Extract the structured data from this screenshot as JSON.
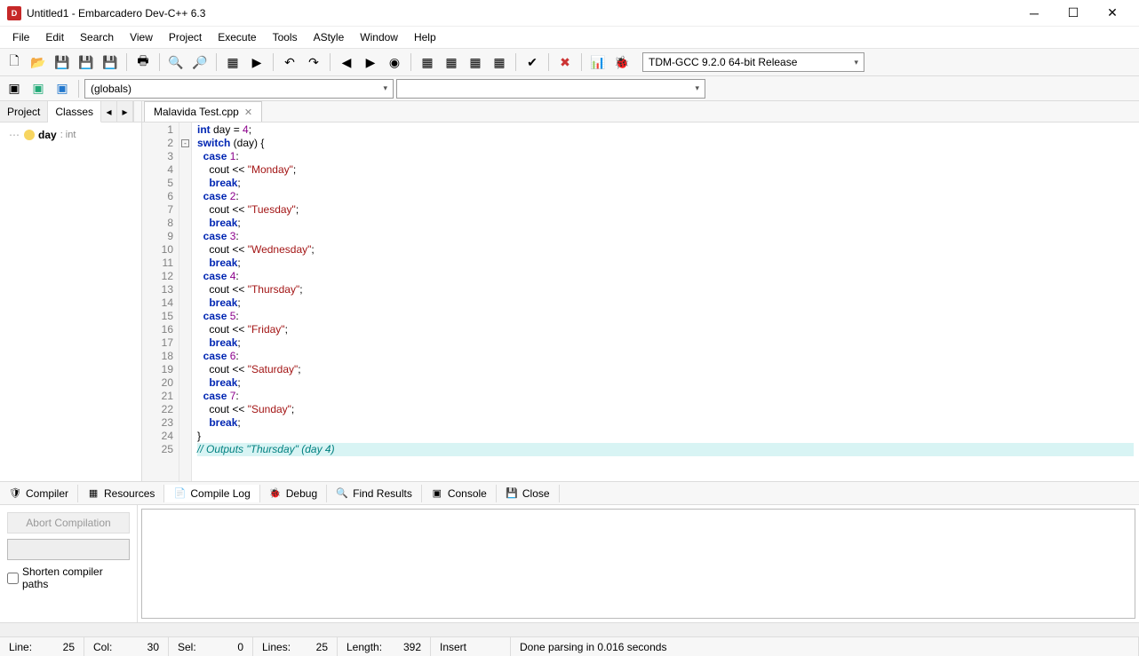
{
  "window": {
    "title": "Untitled1 - Embarcadero Dev-C++ 6.3"
  },
  "menu": [
    "File",
    "Edit",
    "Search",
    "View",
    "Project",
    "Execute",
    "Tools",
    "AStyle",
    "Window",
    "Help"
  ],
  "compiler_dropdown": "TDM-GCC 9.2.0 64-bit Release",
  "scope_dropdown": "(globals)",
  "sidebar": {
    "tabs": [
      "Project",
      "Classes"
    ],
    "active_tab": "Classes",
    "tree": {
      "name": "day",
      "type": ": int"
    }
  },
  "file_tab": {
    "label": "Malavida Test.cpp"
  },
  "code": {
    "line_count": 25,
    "lines": [
      {
        "n": 1,
        "tokens": [
          [
            "kw",
            "int"
          ],
          [
            "",
            " day "
          ],
          [
            "",
            "="
          ],
          [
            "",
            " "
          ],
          [
            "num",
            "4"
          ],
          [
            "",
            ";"
          ]
        ]
      },
      {
        "n": 2,
        "fold": "-",
        "tokens": [
          [
            "kw",
            "switch"
          ],
          [
            "",
            " (day) {"
          ]
        ]
      },
      {
        "n": 3,
        "tokens": [
          [
            "",
            "  "
          ],
          [
            "kw",
            "case"
          ],
          [
            "",
            " "
          ],
          [
            "num",
            "1"
          ],
          [
            "",
            ":"
          ]
        ]
      },
      {
        "n": 4,
        "tokens": [
          [
            "",
            "    cout << "
          ],
          [
            "str",
            "\"Monday\""
          ],
          [
            "",
            ";"
          ]
        ]
      },
      {
        "n": 5,
        "tokens": [
          [
            "",
            "    "
          ],
          [
            "kw",
            "break"
          ],
          [
            "",
            ";"
          ]
        ]
      },
      {
        "n": 6,
        "tokens": [
          [
            "",
            "  "
          ],
          [
            "kw",
            "case"
          ],
          [
            "",
            " "
          ],
          [
            "num",
            "2"
          ],
          [
            "",
            ":"
          ]
        ]
      },
      {
        "n": 7,
        "tokens": [
          [
            "",
            "    cout << "
          ],
          [
            "str",
            "\"Tuesday\""
          ],
          [
            "",
            ";"
          ]
        ]
      },
      {
        "n": 8,
        "tokens": [
          [
            "",
            "    "
          ],
          [
            "kw",
            "break"
          ],
          [
            "",
            ";"
          ]
        ]
      },
      {
        "n": 9,
        "tokens": [
          [
            "",
            "  "
          ],
          [
            "kw",
            "case"
          ],
          [
            "",
            " "
          ],
          [
            "num",
            "3"
          ],
          [
            "",
            ":"
          ]
        ]
      },
      {
        "n": 10,
        "tokens": [
          [
            "",
            "    cout << "
          ],
          [
            "str",
            "\"Wednesday\""
          ],
          [
            "",
            ";"
          ]
        ]
      },
      {
        "n": 11,
        "tokens": [
          [
            "",
            "    "
          ],
          [
            "kw",
            "break"
          ],
          [
            "",
            ";"
          ]
        ]
      },
      {
        "n": 12,
        "tokens": [
          [
            "",
            "  "
          ],
          [
            "kw",
            "case"
          ],
          [
            "",
            " "
          ],
          [
            "num",
            "4"
          ],
          [
            "",
            ":"
          ]
        ]
      },
      {
        "n": 13,
        "tokens": [
          [
            "",
            "    cout << "
          ],
          [
            "str",
            "\"Thursday\""
          ],
          [
            "",
            ";"
          ]
        ]
      },
      {
        "n": 14,
        "tokens": [
          [
            "",
            "    "
          ],
          [
            "kw",
            "break"
          ],
          [
            "",
            ";"
          ]
        ]
      },
      {
        "n": 15,
        "tokens": [
          [
            "",
            "  "
          ],
          [
            "kw",
            "case"
          ],
          [
            "",
            " "
          ],
          [
            "num",
            "5"
          ],
          [
            "",
            ":"
          ]
        ]
      },
      {
        "n": 16,
        "tokens": [
          [
            "",
            "    cout << "
          ],
          [
            "str",
            "\"Friday\""
          ],
          [
            "",
            ";"
          ]
        ]
      },
      {
        "n": 17,
        "tokens": [
          [
            "",
            "    "
          ],
          [
            "kw",
            "break"
          ],
          [
            "",
            ";"
          ]
        ]
      },
      {
        "n": 18,
        "tokens": [
          [
            "",
            "  "
          ],
          [
            "kw",
            "case"
          ],
          [
            "",
            " "
          ],
          [
            "num",
            "6"
          ],
          [
            "",
            ":"
          ]
        ]
      },
      {
        "n": 19,
        "tokens": [
          [
            "",
            "    cout << "
          ],
          [
            "str",
            "\"Saturday\""
          ],
          [
            "",
            ";"
          ]
        ]
      },
      {
        "n": 20,
        "tokens": [
          [
            "",
            "    "
          ],
          [
            "kw",
            "break"
          ],
          [
            "",
            ";"
          ]
        ]
      },
      {
        "n": 21,
        "tokens": [
          [
            "",
            "  "
          ],
          [
            "kw",
            "case"
          ],
          [
            "",
            " "
          ],
          [
            "num",
            "7"
          ],
          [
            "",
            ":"
          ]
        ]
      },
      {
        "n": 22,
        "tokens": [
          [
            "",
            "    cout << "
          ],
          [
            "str",
            "\"Sunday\""
          ],
          [
            "",
            ";"
          ]
        ]
      },
      {
        "n": 23,
        "tokens": [
          [
            "",
            "    "
          ],
          [
            "kw",
            "break"
          ],
          [
            "",
            ";"
          ]
        ]
      },
      {
        "n": 24,
        "tokens": [
          [
            "",
            "}"
          ]
        ]
      },
      {
        "n": 25,
        "highlight": true,
        "tokens": [
          [
            "cmt",
            "// Outputs \"Thursday\" (day 4)"
          ]
        ]
      }
    ]
  },
  "bottom_tabs": [
    {
      "icon": "🛡",
      "label": "Compiler"
    },
    {
      "icon": "▦",
      "label": "Resources"
    },
    {
      "icon": "📄",
      "label": "Compile Log",
      "active": true
    },
    {
      "icon": "🐞",
      "label": "Debug"
    },
    {
      "icon": "🔍",
      "label": "Find Results"
    },
    {
      "icon": "▣",
      "label": "Console"
    },
    {
      "icon": "💾",
      "label": "Close"
    }
  ],
  "compile_controls": {
    "abort": "Abort Compilation",
    "shorten": "Shorten compiler paths"
  },
  "status": {
    "line_label": "Line:",
    "line_val": "25",
    "col_label": "Col:",
    "col_val": "30",
    "sel_label": "Sel:",
    "sel_val": "0",
    "lines_label": "Lines:",
    "lines_val": "25",
    "length_label": "Length:",
    "length_val": "392",
    "mode": "Insert",
    "message": "Done parsing in 0.016 seconds"
  }
}
